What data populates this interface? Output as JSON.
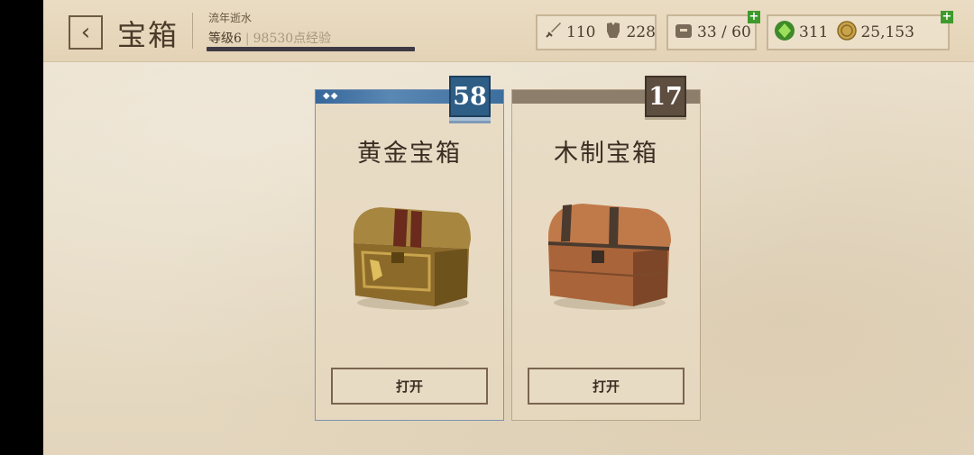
{
  "header": {
    "title": "宝箱",
    "player_name": "流年逝水",
    "level_label": "等级6",
    "exp_label": "98530点经验"
  },
  "stats": {
    "attack": "110",
    "defense": "228",
    "inventory": "33 / 60",
    "gems": "311",
    "coins": "25,153"
  },
  "chests": [
    {
      "name": "黄金宝箱",
      "count": "58",
      "button": "打开"
    },
    {
      "name": "木制宝箱",
      "count": "17",
      "button": "打开"
    }
  ],
  "colors": {
    "gold_accent": "#2e5d86",
    "wood_accent": "#5e4e40",
    "plus": "#3f9a2c"
  }
}
